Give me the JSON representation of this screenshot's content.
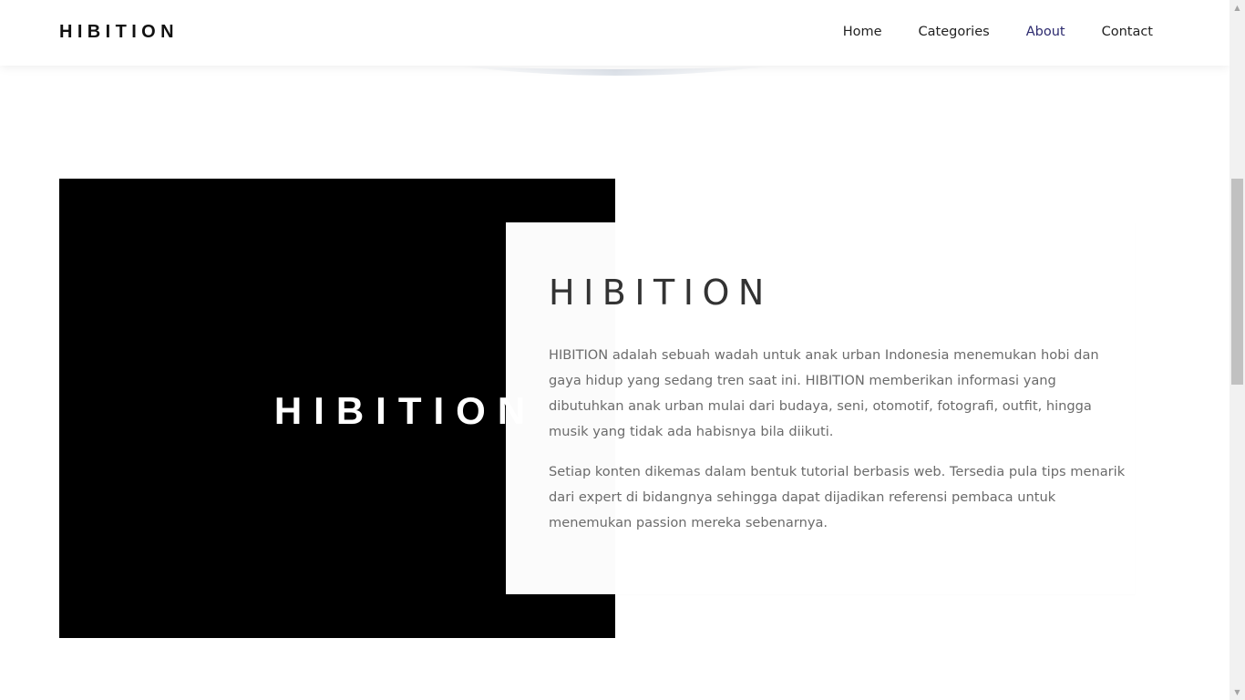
{
  "header": {
    "brand": "HIBITION",
    "nav": [
      {
        "label": "Home",
        "active": false
      },
      {
        "label": "Categories",
        "active": false
      },
      {
        "label": "About",
        "active": true
      },
      {
        "label": "Contact",
        "active": false
      }
    ],
    "active_color": "#2c2a6e"
  },
  "about": {
    "image_logo_text": "HIBITION",
    "title": "HIBITION",
    "paragraphs": [
      "HIBITION adalah sebuah wadah untuk anak urban Indonesia menemukan hobi dan gaya hidup yang sedang tren saat ini. HIBITION memberikan informasi yang dibutuhkan anak urban mulai dari budaya, seni, otomotif, fotografi, outfit, hingga musik yang tidak ada habisnya bila diikuti.",
      "Setiap konten dikemas dalam bentuk tutorial berbasis web. Tersedia pula tips menarik dari expert di bidangnya sehingga dapat dijadikan referensi pembaca untuk menemukan passion mereka sebenarnya."
    ]
  },
  "scrollbar": {
    "up_icon": "triangle-up",
    "down_icon": "triangle-down"
  }
}
